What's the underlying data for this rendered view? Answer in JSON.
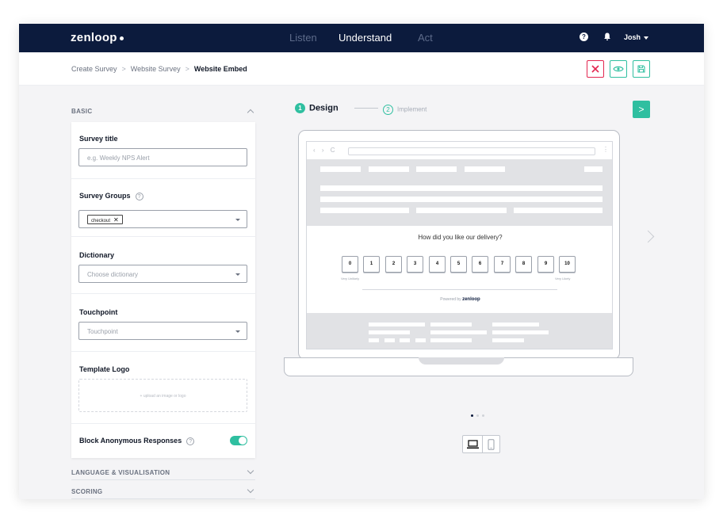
{
  "header": {
    "logo": "zenloop",
    "nav": [
      {
        "label": "Listen",
        "active": false
      },
      {
        "label": "Understand",
        "active": true
      },
      {
        "label": "Act",
        "active": false
      }
    ],
    "help_icon": "?",
    "user_name": "Josh"
  },
  "breadcrumb": {
    "items": [
      "Create Survey",
      "Website Survey",
      "Website Embed"
    ],
    "separator": ">"
  },
  "actions": {
    "close_icon": "close-icon",
    "preview_icon": "eye-icon",
    "save_icon": "save-icon"
  },
  "sidebar": {
    "basic_header": "BASIC",
    "survey_title": {
      "label": "Survey title",
      "placeholder": "e.g. Weekly NPS Alert"
    },
    "survey_groups": {
      "label": "Survey Groups",
      "help": "?",
      "chip": "checkout",
      "chip_remove": "✕"
    },
    "dictionary": {
      "label": "Dictionary",
      "placeholder": "Choose dictionary"
    },
    "touchpoint": {
      "label": "Touchpoint",
      "placeholder": "Touchpoint"
    },
    "template_logo": {
      "label": "Template Logo",
      "upload_text": "+ upload an image or logo"
    },
    "block_anonymous": {
      "label": "Block Anonymous Responses",
      "help": "?",
      "enabled": true
    },
    "collapsed_sections": [
      "LANGUAGE & VISUALISATION",
      "SCORING"
    ]
  },
  "stepper": {
    "steps": [
      {
        "number": "1",
        "label": "Design",
        "active": true
      },
      {
        "number": "2",
        "label": "Implement",
        "active": false
      }
    ],
    "next_label": ">"
  },
  "preview": {
    "question": "How did you like our delivery?",
    "scale": [
      "0",
      "1",
      "2",
      "3",
      "4",
      "5",
      "6",
      "7",
      "8",
      "9",
      "10"
    ],
    "low_label": "Very Unlikely",
    "high_label": "Very Likely",
    "powered_by": "Powered by",
    "powered_brand": "zenloop",
    "browser_nav": "‹ › C",
    "browser_menu": "⋮",
    "slides": 3,
    "active_slide": 1
  },
  "colors": {
    "nav_bg": "#0c1b3d",
    "accent": "#2fbfa0",
    "danger": "#e3264f"
  }
}
